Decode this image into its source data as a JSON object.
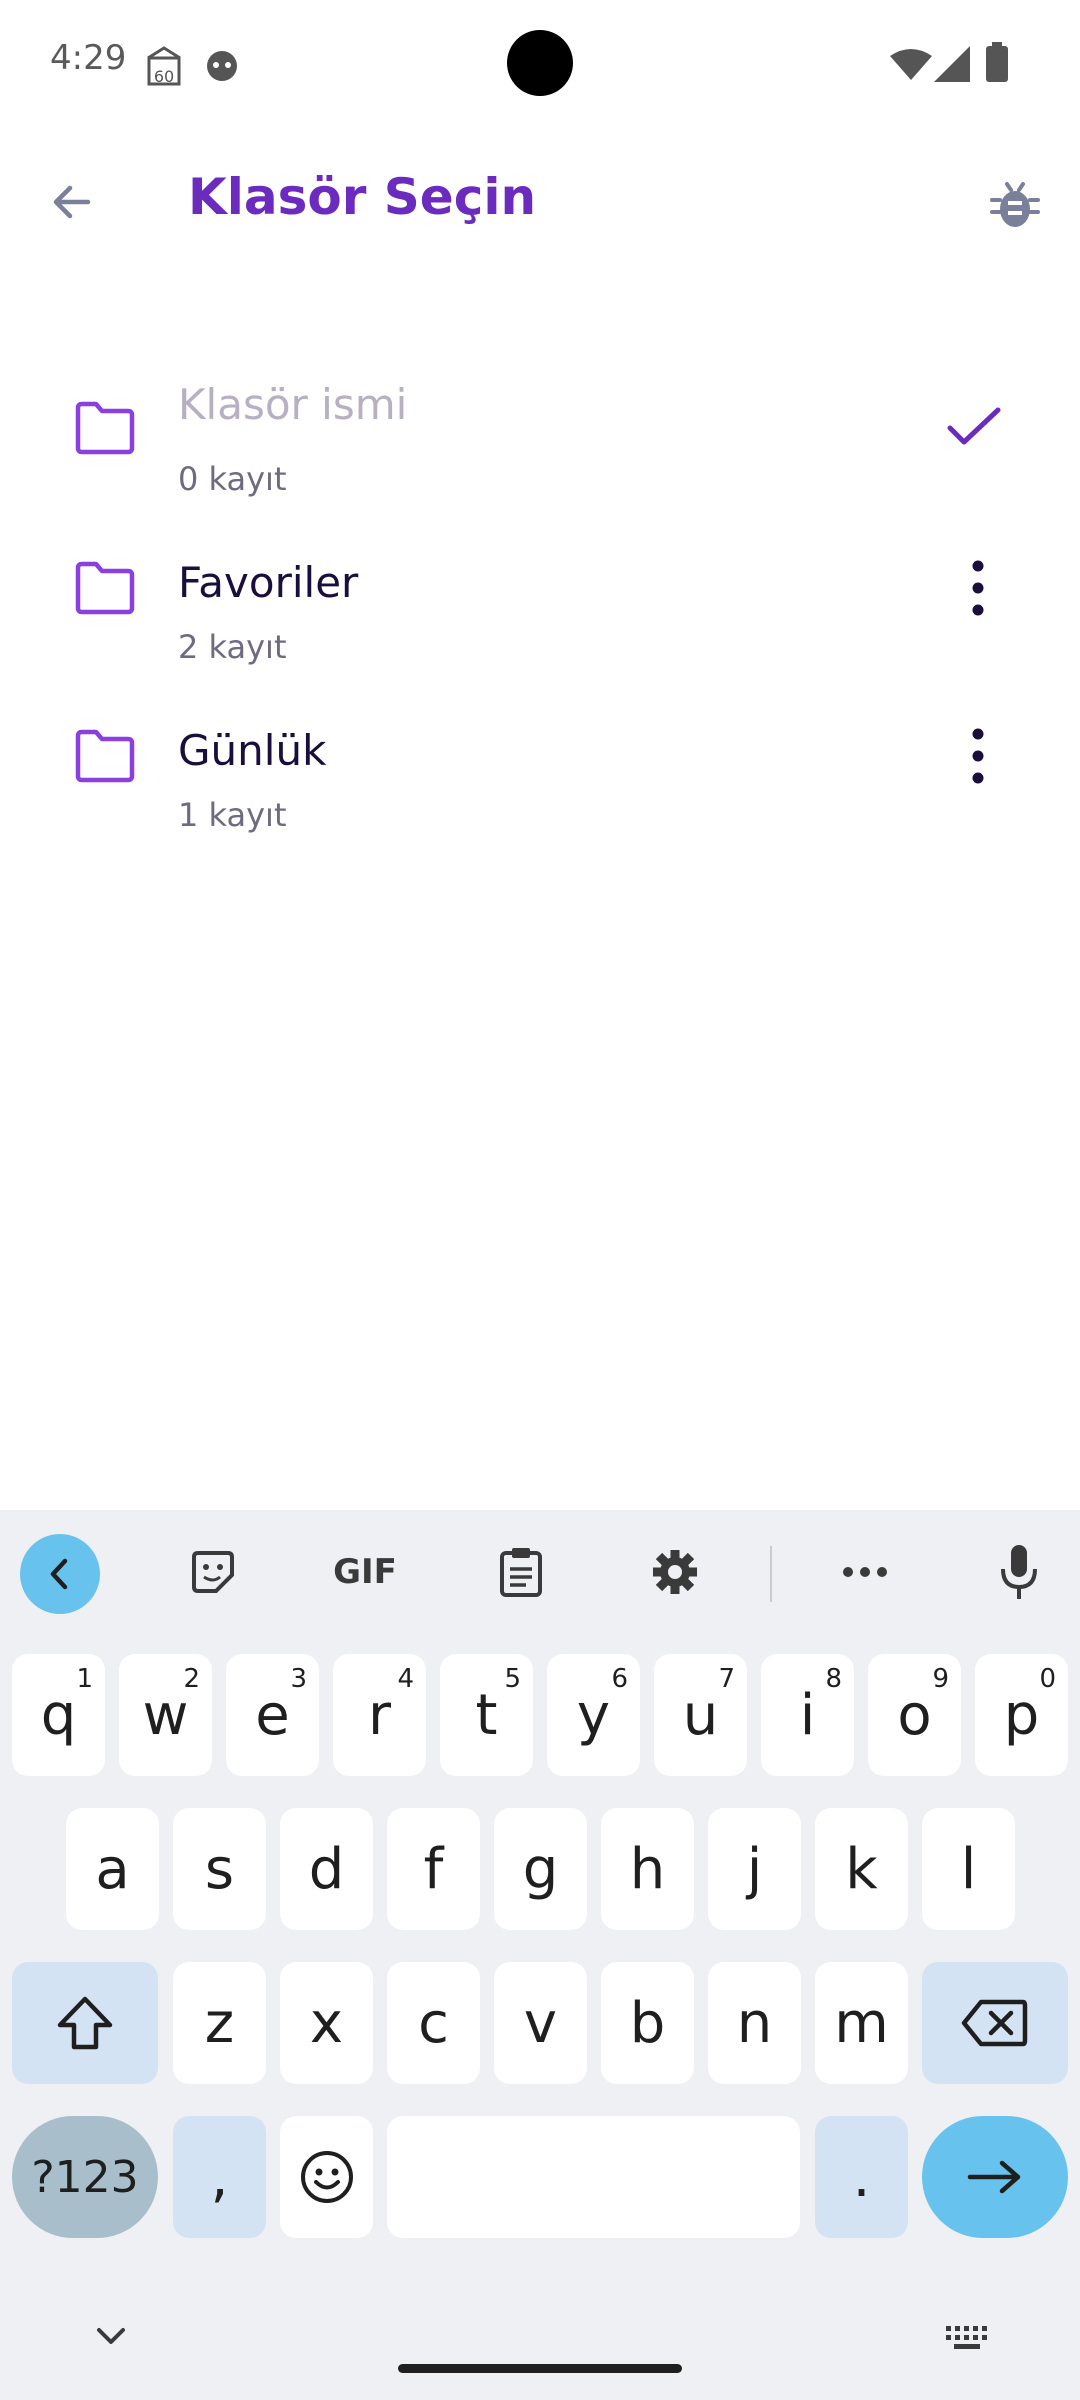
{
  "status_bar": {
    "time": "4:29",
    "badge_number": "60",
    "icons": [
      "mosque-calendar-icon",
      "android-face-icon",
      "wifi-icon",
      "signal-icon",
      "battery-icon"
    ]
  },
  "app_bar": {
    "back_icon": "arrow-back-icon",
    "title": "Klasör Seçin",
    "debug_icon": "bug-icon"
  },
  "folders": [
    {
      "name": "Klasör ismi",
      "count": "0 kayıt",
      "editing": true,
      "action_icon": "check-icon"
    },
    {
      "name": "Favoriler",
      "count": "2 kayıt",
      "editing": false,
      "action_icon": "more-vert-icon"
    },
    {
      "name": "Günlük",
      "count": "1 kayıt",
      "editing": false,
      "action_icon": "more-vert-icon"
    }
  ],
  "keyboard": {
    "toolbar": [
      "chevron-left-icon",
      "sticker-icon",
      "GIF",
      "clipboard-icon",
      "gear-icon",
      "more-horiz-icon",
      "mic-icon"
    ],
    "row1": [
      {
        "k": "q",
        "h": "1"
      },
      {
        "k": "w",
        "h": "2"
      },
      {
        "k": "e",
        "h": "3"
      },
      {
        "k": "r",
        "h": "4"
      },
      {
        "k": "t",
        "h": "5"
      },
      {
        "k": "y",
        "h": "6"
      },
      {
        "k": "u",
        "h": "7"
      },
      {
        "k": "i",
        "h": "8"
      },
      {
        "k": "o",
        "h": "9"
      },
      {
        "k": "p",
        "h": "0"
      }
    ],
    "row2": [
      "a",
      "s",
      "d",
      "f",
      "g",
      "h",
      "j",
      "k",
      "l"
    ],
    "row3": [
      "z",
      "x",
      "c",
      "v",
      "b",
      "n",
      "m"
    ],
    "mode_label": "?123",
    "comma": ",",
    "period": ".",
    "accent": "#67c3ee"
  },
  "colors": {
    "title": "#6b2bbf",
    "folder_icon": "#8a3fe0",
    "check": "#6b2bbf"
  }
}
